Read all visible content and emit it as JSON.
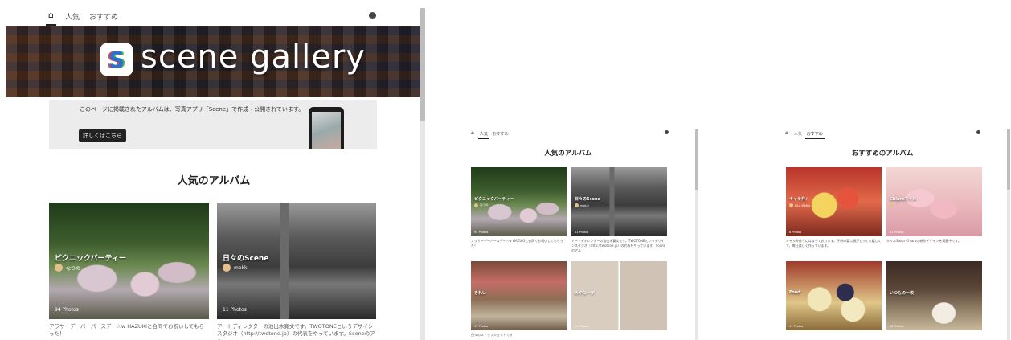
{
  "nav": {
    "home_icon": "home-icon",
    "tab_popular": "人気",
    "tab_recommended": "おすすめ",
    "user_icon": "user-icon"
  },
  "hero": {
    "logo_letter": "S",
    "title": "scene gallery"
  },
  "info": {
    "text": "このページに掲載されたアルバムは、写真アプリ「Scene」で作成・公開されています。",
    "button": "詳しくはこちら"
  },
  "popular": {
    "heading": "人気のアルバム",
    "albums": [
      {
        "title": "ピクニックパーティー",
        "author": "なつの",
        "count": "94 Photos",
        "desc": "アラサーデーパーパースデー☆w HAZUKIと合同でお祝いしてもらった！"
      },
      {
        "title": "日々のScene",
        "author": "mokki",
        "count": "11 Photos",
        "desc": "アートディレクターの池出木寛文です。TWOTONEというデザインスタジオ（http://twotone.jp）の代表をやっています。Sceneのアル"
      }
    ]
  },
  "popular_small": {
    "heading": "人気のアルバム",
    "albums": [
      {
        "title": "ピクニックパーティー",
        "author": "なつの",
        "count": "94 Photos",
        "desc": "アラサーデーパースデー☆w HAZUKIと合同でお祝いしてもらった！"
      },
      {
        "title": "日々のScene",
        "author": "mokki",
        "count": "11 Photos",
        "desc": "アートディレクターの池出木寛文です。TWOTONEというデザインスタジオ（http://twotone.jp）の代表をやっています。Sceneのアル"
      },
      {
        "title": "きれい",
        "author": "",
        "count": "11 Photos",
        "desc": "日々のスナップショットです"
      },
      {
        "title": "みやコーデ",
        "author": "",
        "count": "25 Photos",
        "desc": ""
      }
    ]
  },
  "recommended_small": {
    "heading": "おすすめのアルバム",
    "albums": [
      {
        "title": "キャラ弁♪",
        "author": "LILA MAMA",
        "count": "8 Photos",
        "desc": "キャラ弁作りにはまっております。子供の喜ぶ顔がとっても嬉しくて、毎日楽しく作っています。"
      },
      {
        "title": "Chiaroネイル",
        "author": "",
        "count": "42 Photos",
        "desc": "ネイルSalon Chiaroの新作デザインを掲載中です。"
      },
      {
        "title": "Food",
        "author": "",
        "count": "41 Photos",
        "desc": ""
      },
      {
        "title": "いつもの一枚",
        "author": "",
        "count": "28 Photos",
        "desc": ""
      }
    ]
  }
}
